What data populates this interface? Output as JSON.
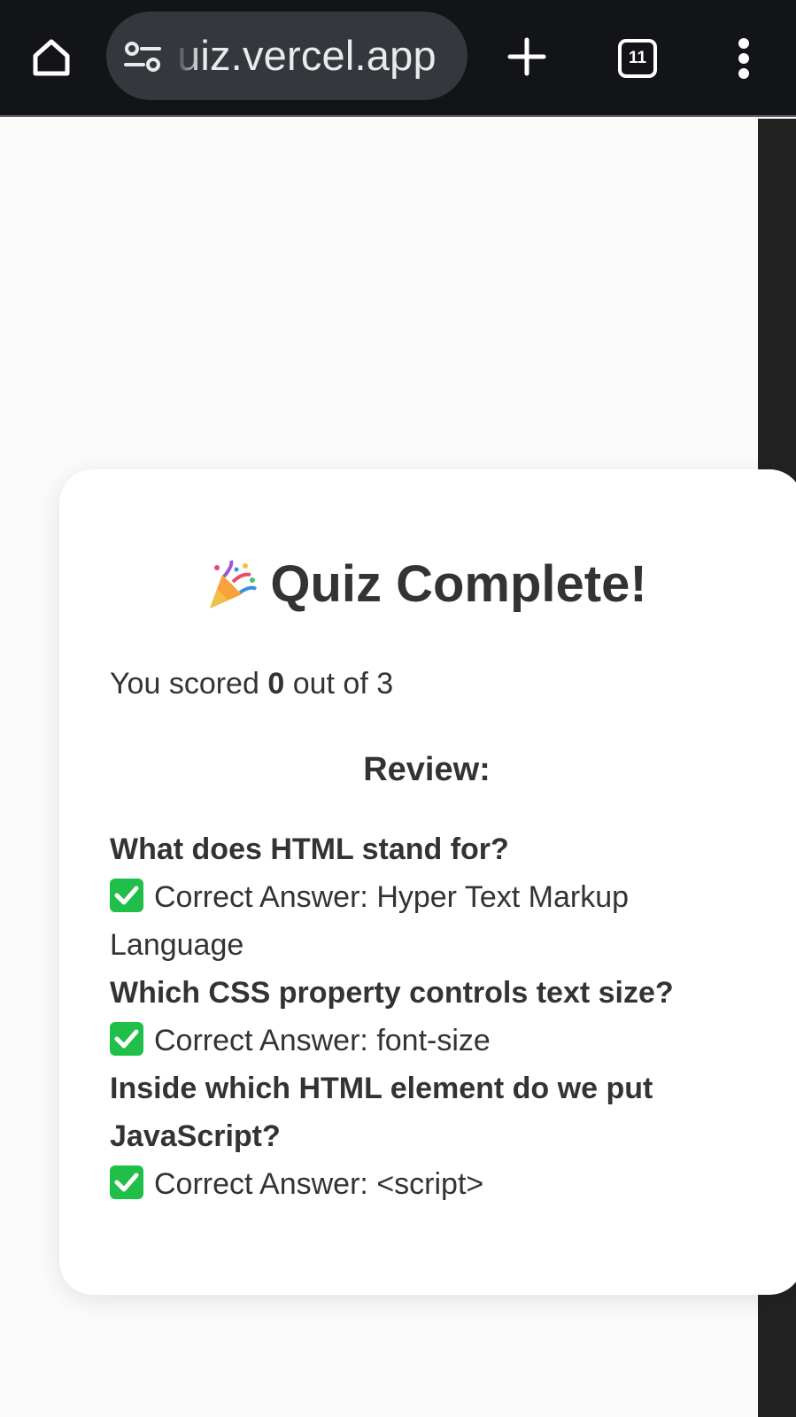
{
  "browser": {
    "url_text": "uiz.vercel.app",
    "tab_count": "11",
    "icons": {
      "home": "home-icon",
      "site_settings": "site-settings-icon",
      "new_tab": "plus-icon",
      "tabs": "tab-switcher-icon",
      "menu": "more-vert-icon"
    }
  },
  "quiz": {
    "title_emoji": "party-popper-icon",
    "title": "Quiz Complete!",
    "score_prefix": "You scored",
    "score_value": "0",
    "score_suffix": "out of 3",
    "review_heading": "Review:",
    "review": [
      {
        "question": "What does HTML stand for?",
        "answer_label": "Correct Answer:",
        "answer": "Hyper Text Markup Language"
      },
      {
        "question": "Which CSS property controls text size?",
        "answer_label": "Correct Answer:",
        "answer": "font-size"
      },
      {
        "question": "Inside which HTML element do we put JavaScript?",
        "answer_label": "Correct Answer:",
        "answer": "<script>"
      }
    ]
  },
  "colors": {
    "browser_bar": "#121418",
    "url_pill": "#34373c",
    "page_background": "#fbfbfb",
    "card_background": "#ffffff",
    "text": "#333333",
    "check_green": "#1fbf4a"
  }
}
